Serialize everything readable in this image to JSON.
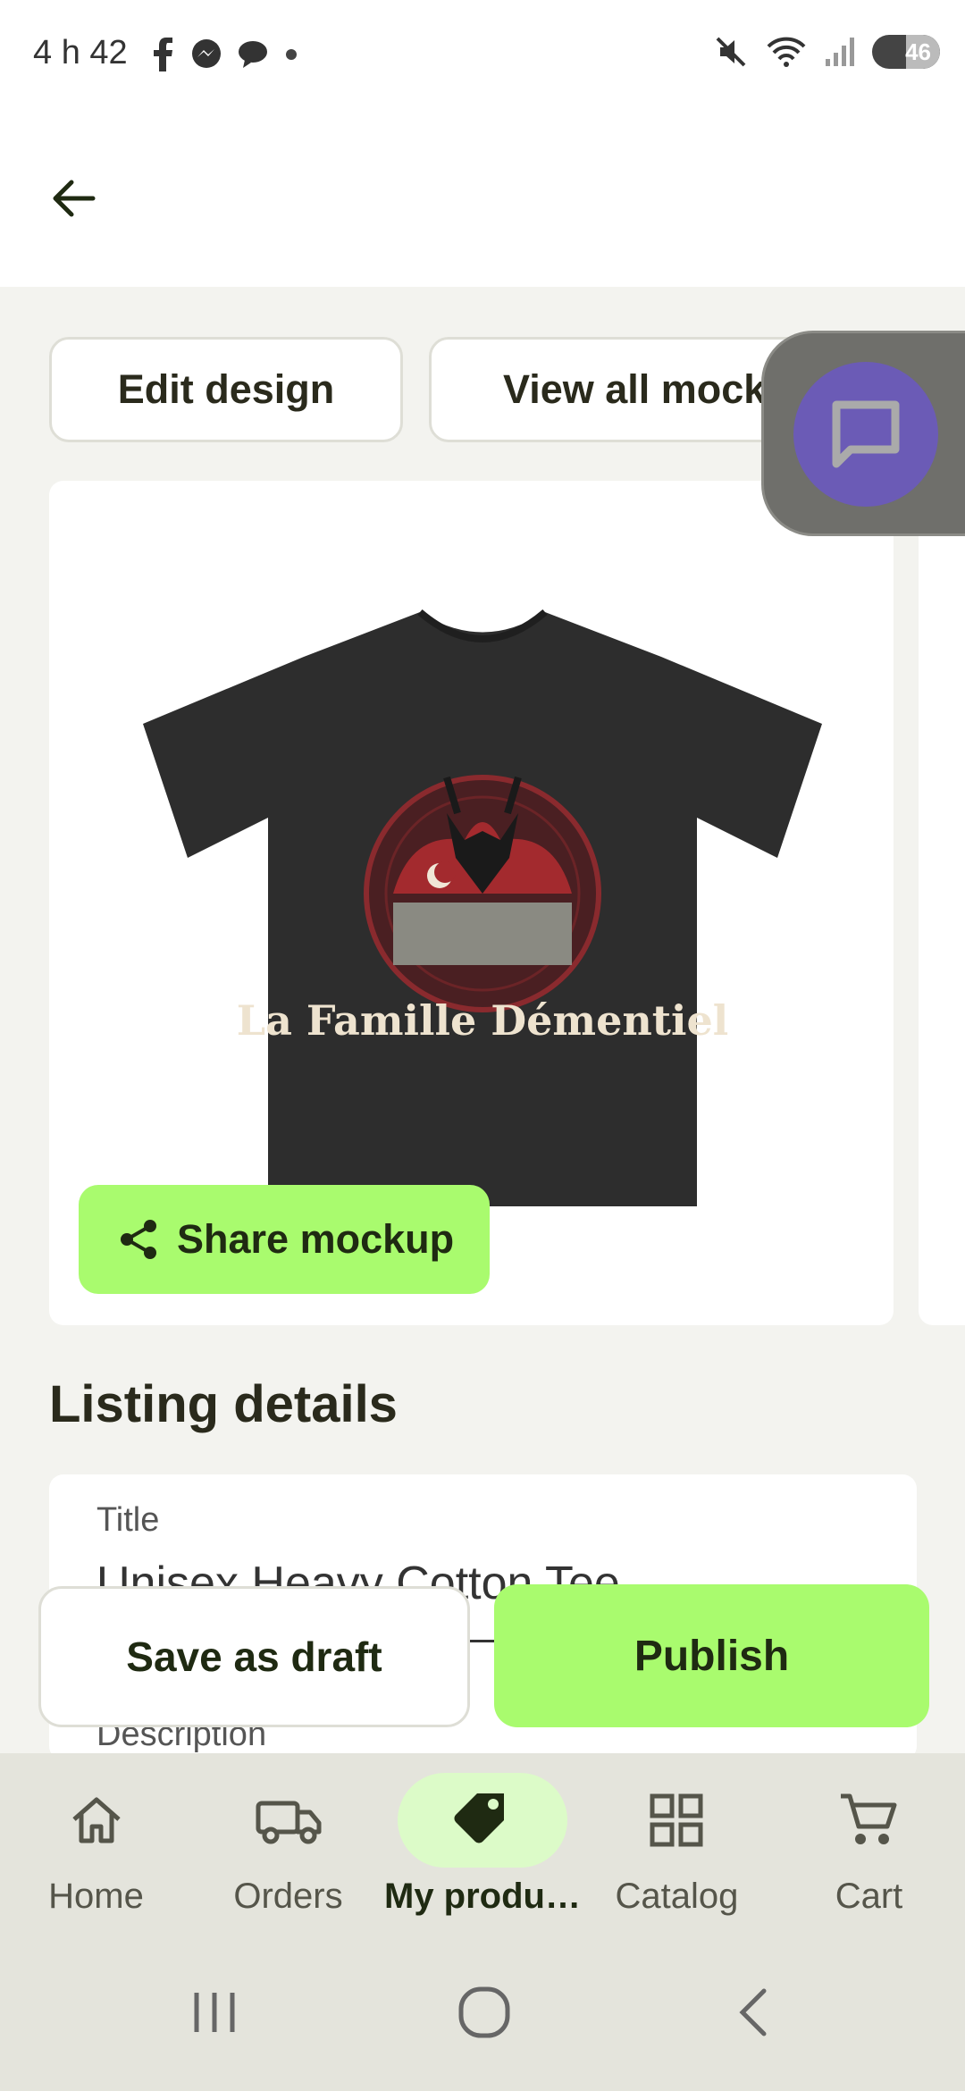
{
  "status_bar": {
    "time": "4 h 42",
    "battery": "46",
    "left_icons": [
      "facebook-icon",
      "messenger-icon",
      "chat-icon",
      "dot-icon"
    ],
    "right_icons": [
      "mute-icon",
      "wifi-icon",
      "signal-icon",
      "battery-icon"
    ]
  },
  "actions": {
    "edit_design": "Edit design",
    "view_all_mockups": "View all mock"
  },
  "mockup": {
    "print_text": "La Famille Démentiel",
    "share_label": "Share mockup"
  },
  "listing": {
    "heading": "Listing details",
    "title_label": "Title",
    "title_value": "Unisex Heavy Cotton Tee",
    "description_label": "Description"
  },
  "footer_actions": {
    "save_draft": "Save as draft",
    "publish": "Publish"
  },
  "bottom_nav": {
    "items": [
      {
        "label": "Home",
        "icon": "home-icon"
      },
      {
        "label": "Orders",
        "icon": "truck-icon"
      },
      {
        "label": "My produ…",
        "icon": "tag-icon"
      },
      {
        "label": "Catalog",
        "icon": "grid-icon"
      },
      {
        "label": "Cart",
        "icon": "cart-icon"
      }
    ]
  },
  "colors": {
    "accent": "#a9fb6e",
    "active_nav_pill": "#dcfbc8",
    "chat_bubble": "#6b5bb6",
    "background": "#f3f3ef"
  }
}
